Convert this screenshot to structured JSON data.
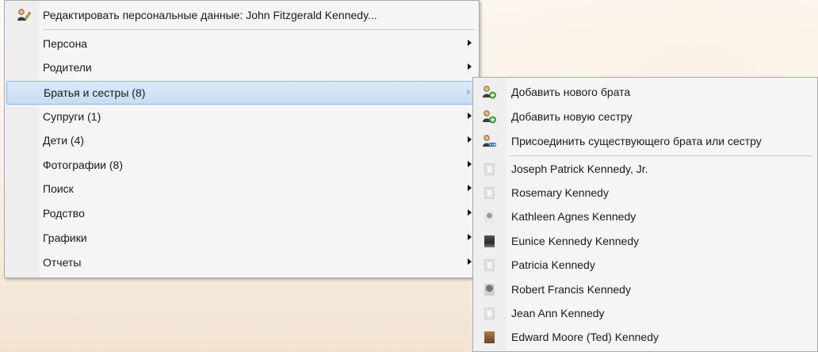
{
  "main_menu": {
    "edit_item": {
      "label": "Редактировать персональные данные: John Fitzgerald Kennedy...",
      "mnemonic": ""
    },
    "items": [
      {
        "label": "Персона",
        "mnemonic": ""
      },
      {
        "label": "Родители",
        "mnemonic": ""
      },
      {
        "label": "Братья и сестры (8)",
        "mnemonic": ""
      },
      {
        "label": "Супруги (1)",
        "mnemonic": ""
      },
      {
        "label": "Дети (4)",
        "mnemonic": ""
      },
      {
        "label": "Фотографии (8)",
        "mnemonic": ""
      },
      {
        "label": "Поиск",
        "mnemonic": ""
      },
      {
        "label": "Родство",
        "mnemonic": ""
      },
      {
        "label": "Графики",
        "mnemonic": ""
      },
      {
        "label": "Отчеты",
        "mnemonic": ""
      }
    ],
    "highlighted_item": "Братья и сестры (8)"
  },
  "submenu": {
    "actions": [
      {
        "label": "Добавить нового брата",
        "icon": "add-person-icon"
      },
      {
        "label": "Добавить новую сестру",
        "icon": "add-person-icon"
      },
      {
        "label": "Присоединить существующего брата или сестру",
        "icon": "link-person-icon"
      }
    ],
    "siblings": [
      {
        "name": "Joseph Patrick Kennedy, Jr.",
        "photo": "blank"
      },
      {
        "name": "Rosemary Kennedy",
        "photo": "blank"
      },
      {
        "name": "Kathleen Agnes Kennedy",
        "photo": "photo"
      },
      {
        "name": "Eunice Kennedy Kennedy",
        "photo": "photo"
      },
      {
        "name": "Patricia Kennedy",
        "photo": "blank"
      },
      {
        "name": "Robert Francis Kennedy",
        "photo": "photo"
      },
      {
        "name": "Jean Ann Kennedy",
        "photo": "blank"
      },
      {
        "name": "Edward Moore (Ted) Kennedy",
        "photo": "photo"
      }
    ]
  },
  "colors": {
    "highlight_bg": "#c6dcf3",
    "highlight_border": "#91b7e0",
    "menu_bg": "#f5f5f5",
    "gutter_bg": "#efefef"
  }
}
